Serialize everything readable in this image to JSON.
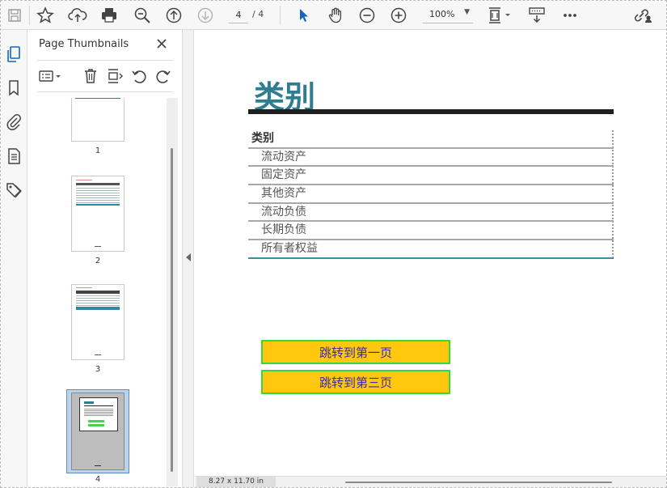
{
  "toolbar": {
    "icons": [
      "save-icon",
      "star-icon",
      "upload-cloud-icon",
      "print-icon",
      "zoom-out-search-icon",
      "page-up-icon",
      "page-down-icon",
      "select-arrow-icon",
      "hand-icon",
      "zoom-out-icon",
      "zoom-in-icon",
      "fit-page-icon",
      "scroll-mode-icon",
      "more-icon",
      "share-link-icon"
    ],
    "current_page": "4",
    "page_of": "/  4",
    "zoom": "100%"
  },
  "rail": {
    "icons": [
      "page-thumbnails-icon",
      "bookmark-icon",
      "attachment-icon",
      "layers-icon",
      "tag-icon"
    ],
    "active_color": "#1565c0"
  },
  "panel": {
    "title": "Page Thumbnails",
    "thumbnails": [
      {
        "label": "1"
      },
      {
        "label": "2"
      },
      {
        "label": "3"
      },
      {
        "label": "4",
        "selected": true
      }
    ]
  },
  "document": {
    "heading": "类别",
    "heading_color": "#2e7d90",
    "table_header": "类别",
    "rows": [
      "流动资产",
      "固定资产",
      "其他资产",
      "流动负债",
      "长期负债",
      "所有者权益"
    ],
    "buttons": [
      "跳转到第一页",
      "跳转到第三页"
    ],
    "button_fill": "#ffc70d",
    "button_border": "#36d936",
    "button_text_color": "#3a2bb4"
  },
  "status": {
    "page_size": "8.27 x 11.70 in"
  }
}
